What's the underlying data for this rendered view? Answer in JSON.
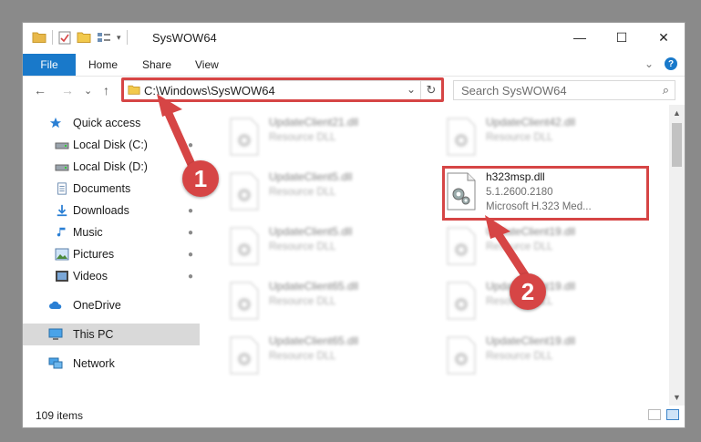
{
  "window": {
    "title": "SysWOW64"
  },
  "controls": {
    "minimize": "—",
    "maximize": "☐",
    "close": "✕"
  },
  "ribbon": {
    "file": "File",
    "tabs": [
      "Home",
      "Share",
      "View"
    ],
    "chevron": "⌄",
    "help": "?"
  },
  "nav": {
    "back": "←",
    "forward": "→",
    "recent": "⌄",
    "up": "↑",
    "address": "C:\\Windows\\SysWOW64",
    "address_dropdown": "⌄",
    "refresh": "↻",
    "search_placeholder": "Search SysWOW64",
    "search_icon": "⌕"
  },
  "sidebar": {
    "items": [
      {
        "label": "Quick access",
        "icon": "star-icon",
        "pinned": false
      },
      {
        "label": "Local Disk (C:)",
        "icon": "drive-icon",
        "pinned": true
      },
      {
        "label": "Local Disk (D:)",
        "icon": "drive-icon",
        "pinned": false
      },
      {
        "label": "Documents",
        "icon": "documents-icon",
        "pinned": true
      },
      {
        "label": "Downloads",
        "icon": "download-icon",
        "pinned": true
      },
      {
        "label": "Music",
        "icon": "music-icon",
        "pinned": true
      },
      {
        "label": "Pictures",
        "icon": "pictures-icon",
        "pinned": true
      },
      {
        "label": "Videos",
        "icon": "videos-icon",
        "pinned": true
      },
      {
        "label": "OneDrive",
        "icon": "cloud-icon",
        "pinned": false
      },
      {
        "label": "This PC",
        "icon": "computer-icon",
        "pinned": false,
        "selected": true
      },
      {
        "label": "Network",
        "icon": "network-icon",
        "pinned": false
      }
    ],
    "pin_glyph": "📌"
  },
  "files": {
    "left": [
      {
        "name": "UpdateClient21.dll",
        "type": "Resource DLL"
      },
      {
        "name": "UpdateClient5.dll",
        "type": "Resource DLL"
      },
      {
        "name": "UpdateClient5.dll",
        "type": "Resource DLL"
      },
      {
        "name": "UpdateClient65.dll",
        "type": "Resource DLL"
      },
      {
        "name": "UpdateClient65.dll",
        "type": "Resource DLL"
      }
    ],
    "right": [
      {
        "name": "UpdateClient42.dll",
        "type": "Resource DLL"
      },
      {
        "name": "UpdateClient19.dll",
        "type": "Resource DLL"
      },
      {
        "name": "UpdateClient19.dll",
        "type": "Resource DLL"
      },
      {
        "name": "UpdateClient19.dll",
        "type": "Resource DLL"
      }
    ],
    "target": {
      "name": "h323msp.dll",
      "version": "5.1.2600.2180",
      "description": "Microsoft H.323 Med..."
    }
  },
  "status": {
    "count": "109 items"
  },
  "callouts": {
    "one": "1",
    "two": "2"
  },
  "colors": {
    "accent": "#1979ca",
    "highlight": "#d64545",
    "selected": "#d9d9d9"
  }
}
